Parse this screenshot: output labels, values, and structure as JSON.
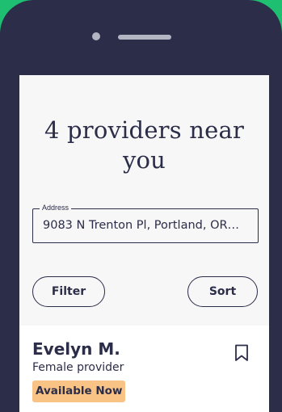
{
  "header": {
    "title": "4 providers near you"
  },
  "address": {
    "label": "Address",
    "value": "9083 N Trenton Pl, Portland, OR…"
  },
  "actions": {
    "filter_label": "Filter",
    "sort_label": "Sort"
  },
  "providers": [
    {
      "name": "Evelyn M.",
      "subtitle": "Female provider",
      "status": "Available Now"
    }
  ],
  "icons": {
    "bookmark": "bookmark-icon"
  },
  "colors": {
    "ink": "#2b2d49",
    "badge": "#f8c384",
    "background": "#1fbf72",
    "screen": "#f7f7f7"
  }
}
